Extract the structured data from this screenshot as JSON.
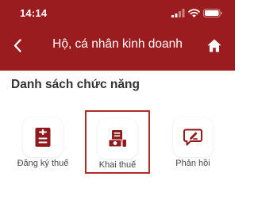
{
  "status_bar": {
    "time": "14:14"
  },
  "header": {
    "title": "Hộ, cá nhân kinh doanh",
    "back_icon": "chevron-left-icon",
    "home_icon": "home-icon",
    "background_color": "#9b1c1e"
  },
  "section": {
    "title": "Danh sách chức năng"
  },
  "functions": [
    {
      "label": "Đăng ký thuế",
      "icon": "document-list-icon",
      "selected": false
    },
    {
      "label": "Khai thuế",
      "icon": "tax-declaration-icon",
      "selected": true
    },
    {
      "label": "Phản hồi",
      "icon": "feedback-edit-icon",
      "selected": false
    }
  ],
  "accent_color": "#9b1c1e"
}
